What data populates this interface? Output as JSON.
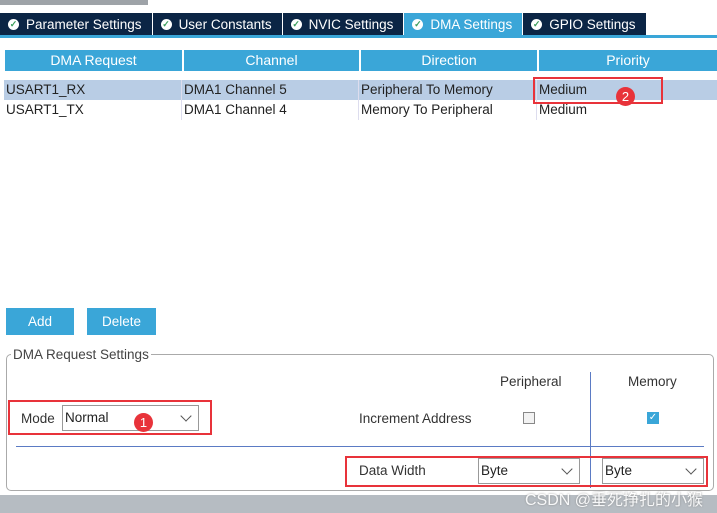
{
  "tabs": [
    {
      "label": "Parameter Settings"
    },
    {
      "label": "User Constants"
    },
    {
      "label": "NVIC Settings"
    },
    {
      "label": "DMA Settings",
      "active": true
    },
    {
      "label": "GPIO Settings"
    }
  ],
  "table": {
    "columns": [
      "DMA Request",
      "Channel",
      "Direction",
      "Priority"
    ],
    "rows": [
      [
        "USART1_RX",
        "DMA1 Channel 5",
        "Peripheral To Memory",
        "Medium"
      ],
      [
        "USART1_TX",
        "DMA1 Channel 4",
        "Memory To Peripheral",
        "Medium"
      ]
    ],
    "selected_row": 0
  },
  "buttons": {
    "add": "Add",
    "delete": "Delete"
  },
  "settings": {
    "title": "DMA Request Settings",
    "mode_label": "Mode",
    "mode_value": "Normal",
    "peripheral_header": "Peripheral",
    "memory_header": "Memory",
    "increment_label": "Increment Address",
    "increment_peripheral": false,
    "increment_memory": true,
    "data_width_label": "Data Width",
    "data_width_peripheral": "Byte",
    "data_width_memory": "Byte"
  },
  "annotations": {
    "badge1": "1",
    "badge2": "2"
  },
  "watermark": "CSDN @垂死挣扎的小猴",
  "colors": {
    "accent": "#3aa6d8",
    "tab_dark": "#0b2545",
    "highlight": "#e8333a",
    "selected_row": "#b9cde5"
  }
}
